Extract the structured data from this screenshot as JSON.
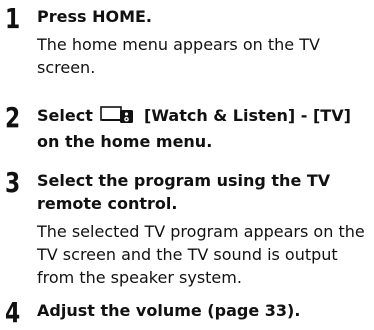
{
  "steps": [
    {
      "number": "1",
      "heading": "Press HOME.",
      "body": "The home menu appears on the TV screen."
    },
    {
      "number": "2",
      "heading_pre": "Select",
      "icon": "watch-listen-icon",
      "heading_post": "[Watch & Listen] - [TV] on the home menu."
    },
    {
      "number": "3",
      "heading": "Select the program using the TV remote control.",
      "body": "The selected TV program appears on the TV screen and the TV sound is output from the speaker system."
    },
    {
      "number": "4",
      "heading": "Adjust the volume (page 33)."
    }
  ]
}
